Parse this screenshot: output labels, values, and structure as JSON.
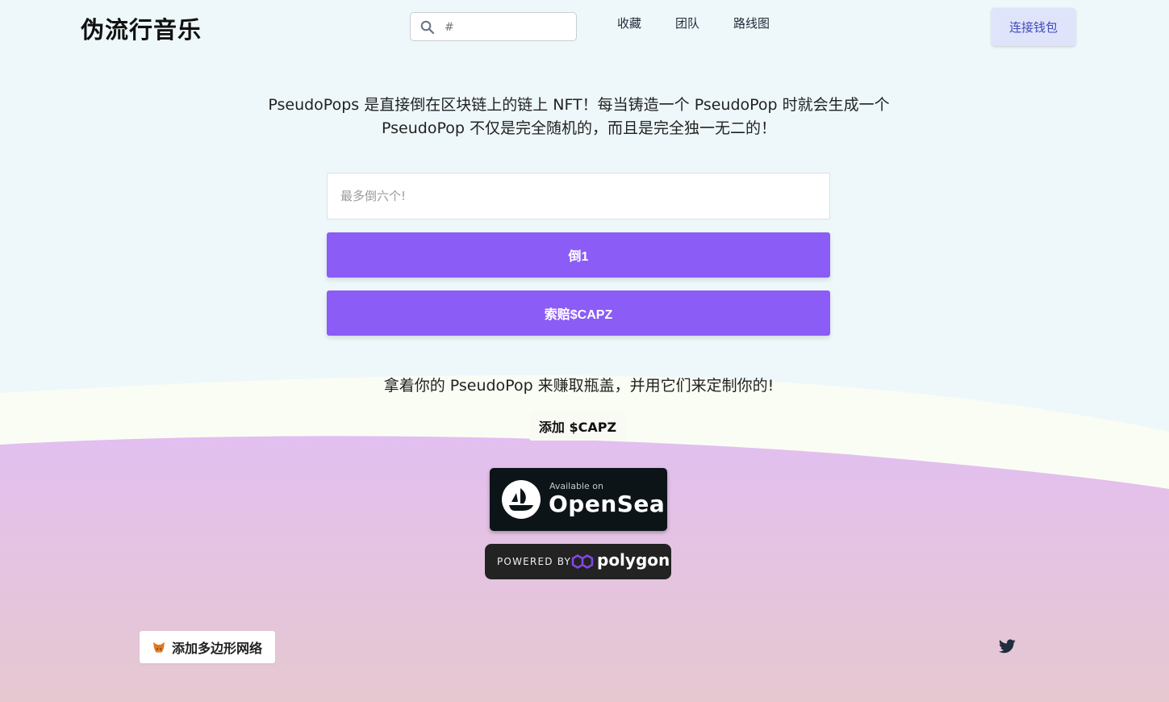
{
  "header": {
    "logo": "伪流行音乐",
    "search": {
      "placeholder": "#"
    },
    "nav": [
      "收藏",
      "团队",
      "路线图"
    ],
    "connect_wallet": "连接钱包"
  },
  "main": {
    "intro": "PseudoPops 是直接倒在区块链上的链上 NFT！每当铸造一个 PseudoPop 时就会生成一个 PseudoPop 不仅是完全随机的，而且是完全独一无二的！",
    "amount_placeholder": "最多倒六个!",
    "pour_button": "倒1",
    "claim_button": "索赔$CAPZ",
    "hold_text": "拿着你的 PseudoPop 来赚取瓶盖，并用它们来定制你的!",
    "add_capz": "添加 $CAPZ"
  },
  "badges": {
    "opensea": {
      "small": "Available on",
      "big": "OpenSea"
    },
    "polygon": {
      "small": "POWERED BY",
      "name": "polygon"
    }
  },
  "footer": {
    "add_network": "添加多边形网络"
  },
  "colors": {
    "accent": "#8b5cf6",
    "wallet_button_bg": "#e0e4fb",
    "wallet_button_text": "#3f4bb8",
    "background_top": "#eef8fa",
    "wave_light": "#fafdf4",
    "gradient_purple": "#e2bff0",
    "gradient_bottom": "#e6c8d0"
  },
  "icons": [
    "search-icon",
    "opensea-icon",
    "polygon-icon",
    "metamask-fox-icon",
    "twitter-icon"
  ]
}
